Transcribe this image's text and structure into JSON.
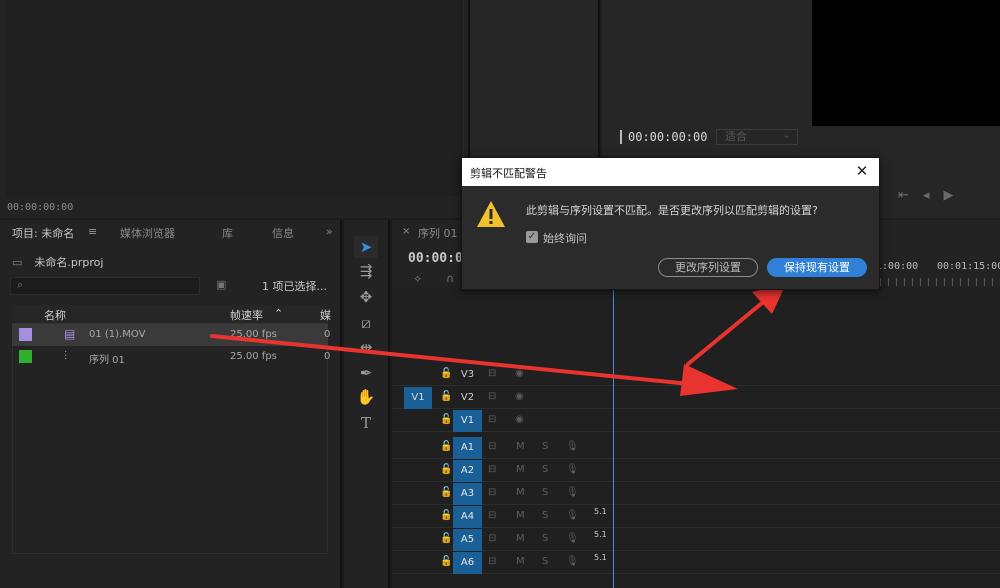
{
  "source_monitor": {
    "timecode": "00:00:00:00"
  },
  "program_monitor": {
    "timecode": "00:00:00:00",
    "fit_label": "适合"
  },
  "project": {
    "tabs": [
      "项目: 未命名",
      "媒体浏览器",
      "库",
      "信息"
    ],
    "tab_menu": "≡",
    "tab_more": "»",
    "file_name": "未命名.prproj",
    "selection_count": "1 项已选择...",
    "columns": {
      "name": "名称",
      "framerate": "帧速率",
      "extra": "媒"
    },
    "items": [
      {
        "name": "01 (1).MOV",
        "framerate": "25.00 fps",
        "extra": "0",
        "color": "#a88ee0"
      },
      {
        "name": "序列 01",
        "framerate": "25.00 fps",
        "extra": "0",
        "color": "#30b030"
      }
    ]
  },
  "timeline": {
    "tab_close": "×",
    "tab_name": "序列 01",
    "timecode": "00:00:0",
    "ruler_labels": [
      "01:00:00",
      "00:01:15:00"
    ],
    "source_patch": "V1",
    "video_tracks": [
      "V3",
      "V2",
      "V1"
    ],
    "audio_tracks": [
      "A1",
      "A2",
      "A3",
      "A4",
      "A5",
      "A6"
    ],
    "mute_label": "M",
    "solo_label": "S",
    "channel_label": "5.1"
  },
  "dialog": {
    "title": "剪辑不匹配警告",
    "message": "此剪辑与序列设置不匹配。是否更改序列以匹配剪辑的设置?",
    "checkbox_label": "始终询问",
    "checkbox_checked": true,
    "change_button": "更改序列设置",
    "keep_button": "保持现有设置"
  },
  "annotation_color": "#e8332e"
}
